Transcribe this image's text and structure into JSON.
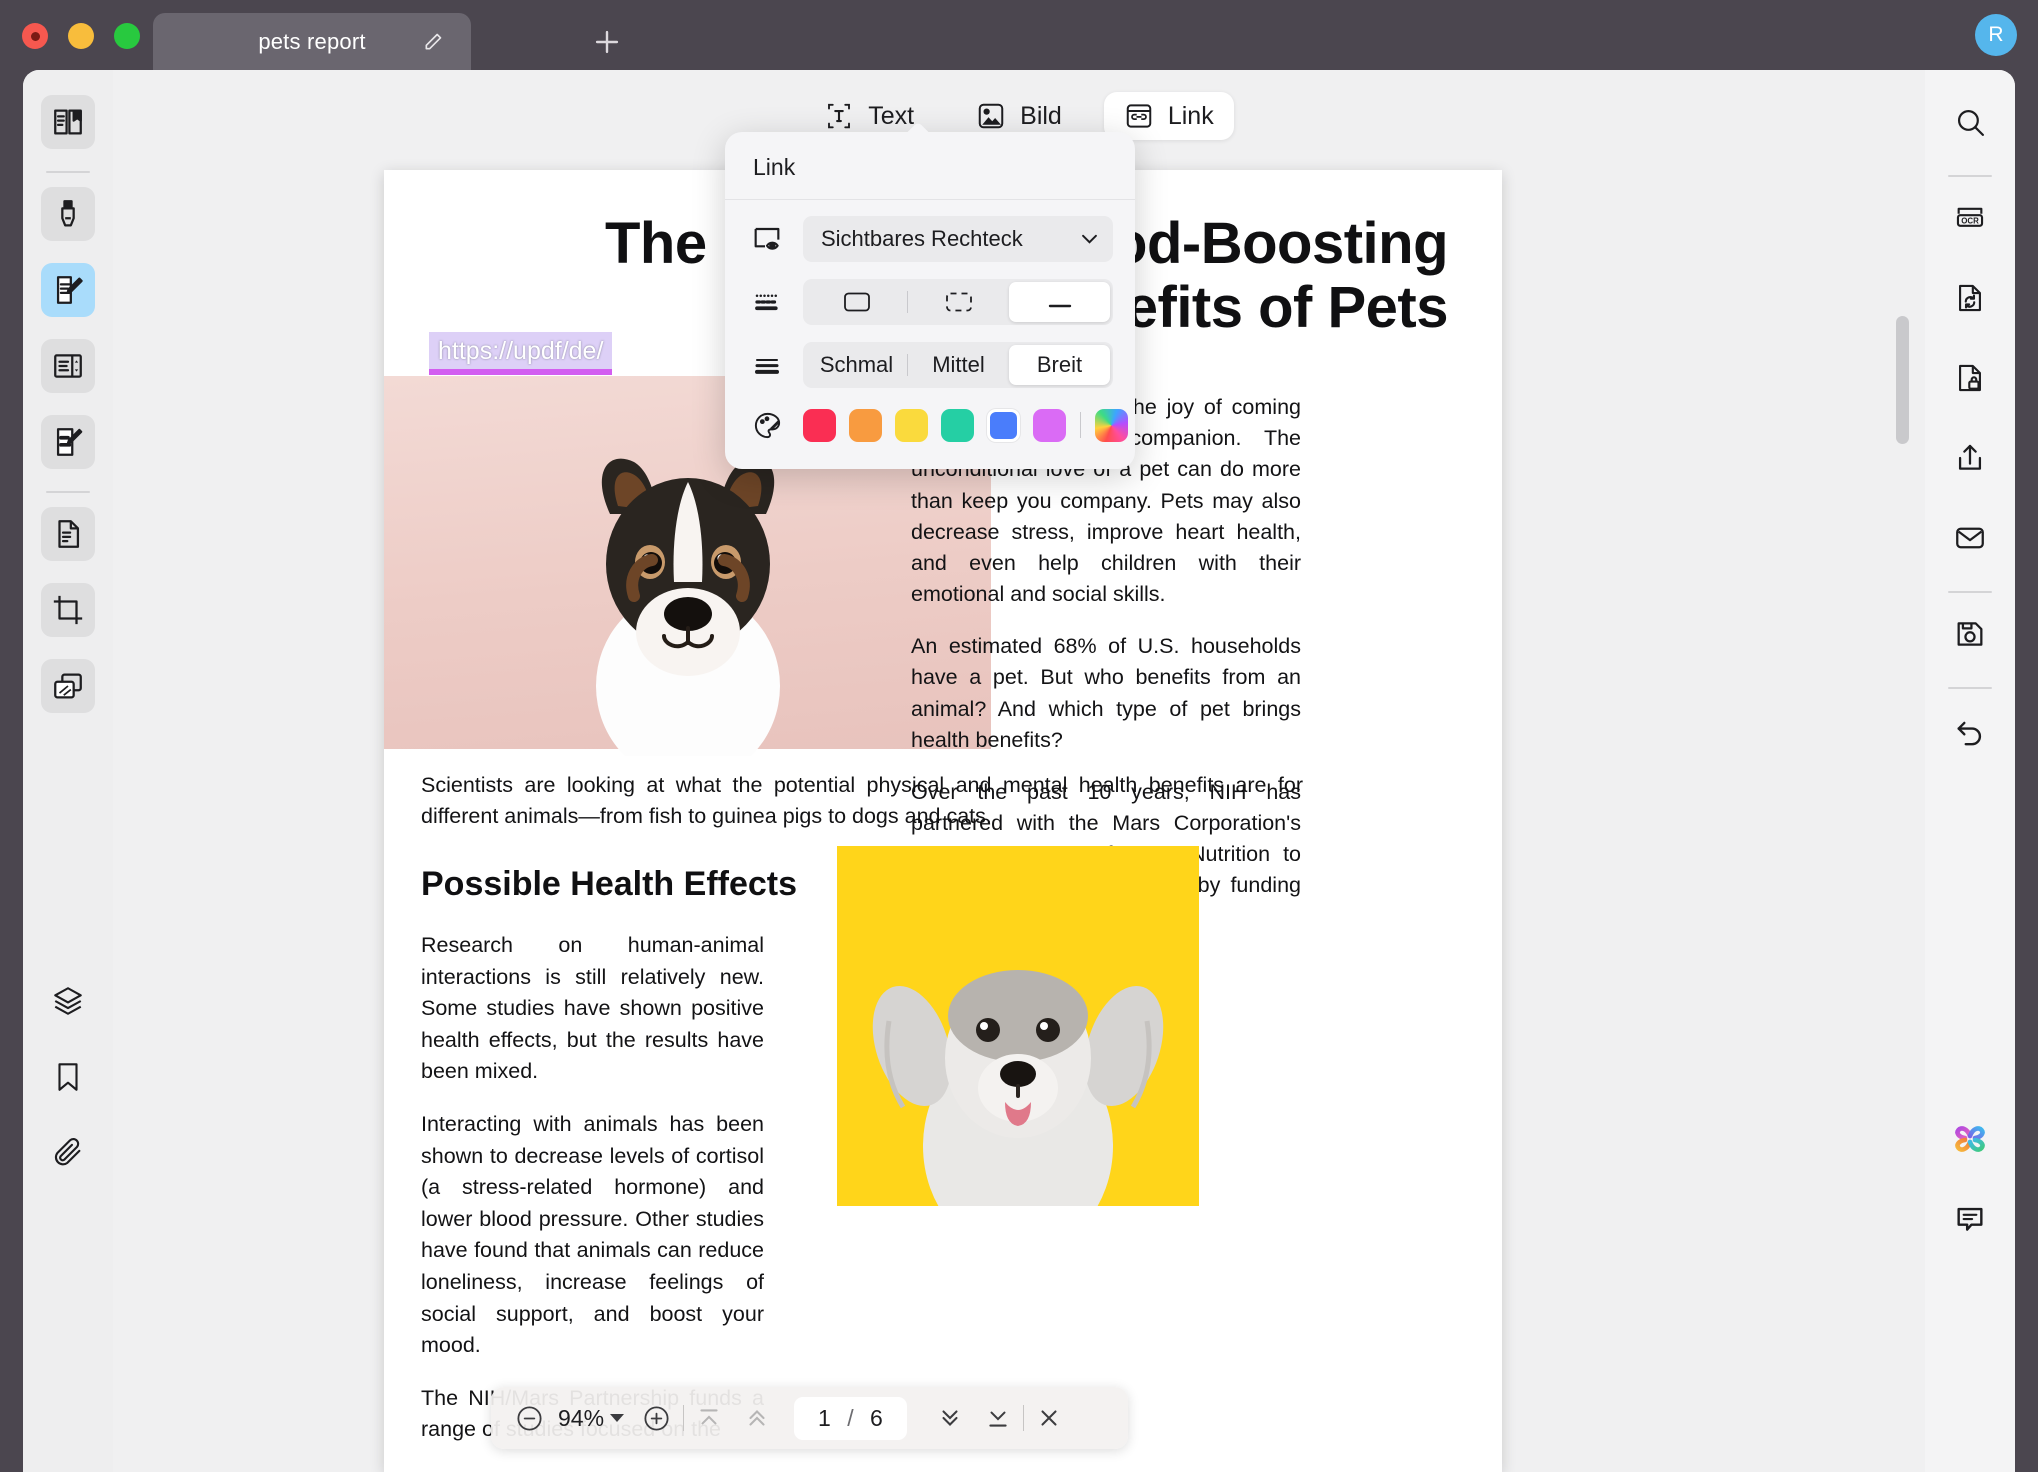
{
  "titlebar": {
    "tab_title": "pets report",
    "edit_icon": "pencil-icon",
    "new_tab_icon": "plus-icon",
    "avatar_initial": "R",
    "avatar_color": "#55b6ec"
  },
  "toolbar": {
    "tabs": [
      {
        "label": "Text",
        "icon": "text-box-icon",
        "selected": false
      },
      {
        "label": "Bild",
        "icon": "image-icon",
        "selected": false
      },
      {
        "label": "Link",
        "icon": "link-card-icon",
        "selected": true
      }
    ]
  },
  "left_rail": {
    "items": [
      {
        "name": "thumbnail-panel",
        "icon": "book-open-icon",
        "state": "shaded"
      },
      {
        "separator": true
      },
      {
        "name": "highlight-tool",
        "icon": "marker-icon",
        "state": "shaded"
      },
      {
        "name": "edit-tool",
        "icon": "document-pencil-icon",
        "state": "active"
      },
      {
        "name": "reading-tool",
        "icon": "document-columns-icon",
        "state": "shaded"
      },
      {
        "name": "form-tool",
        "icon": "form-pen-icon",
        "state": "shaded"
      },
      {
        "separator": true
      },
      {
        "name": "organize-pages",
        "icon": "page-fold-icon",
        "state": "shaded"
      },
      {
        "name": "crop-tool",
        "icon": "crop-icon",
        "state": "shaded"
      },
      {
        "name": "compare-tool",
        "icon": "stacked-pages-icon",
        "state": "shaded"
      }
    ],
    "bottom_items": [
      {
        "name": "layers",
        "icon": "layers-icon"
      },
      {
        "name": "bookmarks",
        "icon": "bookmark-icon"
      },
      {
        "name": "attachments",
        "icon": "paperclip-icon"
      }
    ]
  },
  "right_rail": {
    "items": [
      {
        "name": "search",
        "icon": "search-icon"
      },
      {
        "separator": true
      },
      {
        "name": "ocr",
        "icon": "ocr-icon",
        "label": "OCR"
      },
      {
        "name": "convert",
        "icon": "convert-document-icon"
      },
      {
        "name": "protect",
        "icon": "lock-document-icon"
      },
      {
        "name": "share",
        "icon": "share-icon"
      },
      {
        "name": "email",
        "icon": "envelope-icon"
      },
      {
        "separator": true
      },
      {
        "name": "save",
        "icon": "save-disk-icon"
      },
      {
        "separator": true
      },
      {
        "name": "undo",
        "icon": "undo-arrow-icon"
      }
    ],
    "bottom_items": [
      {
        "name": "ai-assistant",
        "icon": "ai-clover-icon"
      },
      {
        "name": "comments",
        "icon": "comment-bubble-icon"
      }
    ]
  },
  "popup": {
    "title": "Link",
    "appearance": {
      "icon": "visible-rectangle-icon",
      "value": "Sichtbares Rechteck",
      "chevron": "chevron-down-icon"
    },
    "border_style": {
      "icon": "border-style-icon",
      "options": [
        {
          "name": "solid-rectangle",
          "icon": "solid-rect-icon",
          "selected": false
        },
        {
          "name": "dashed-rectangle",
          "icon": "dashed-rect-icon",
          "selected": false
        },
        {
          "name": "underline",
          "icon": "underline-icon",
          "selected": true
        }
      ]
    },
    "thickness": {
      "icon": "line-thickness-icon",
      "options": [
        {
          "label": "Schmal",
          "selected": false
        },
        {
          "label": "Mittel",
          "selected": false
        },
        {
          "label": "Breit",
          "selected": true
        }
      ]
    },
    "color": {
      "icon": "palette-icon",
      "swatches": [
        {
          "name": "red",
          "hex": "#fa2e53",
          "selected": false
        },
        {
          "name": "orange",
          "hex": "#f89b40",
          "selected": false
        },
        {
          "name": "yellow",
          "hex": "#fada3d",
          "selected": false
        },
        {
          "name": "green",
          "hex": "#25cfa4",
          "selected": false
        },
        {
          "name": "blue",
          "hex": "#4a7dfb",
          "selected": true
        },
        {
          "name": "magenta",
          "hex": "#da6bf5",
          "selected": false
        }
      ],
      "custom": {
        "name": "custom-color-picker",
        "hex": "rainbow"
      }
    }
  },
  "document": {
    "title": "The Health and Mood-Boosting Benefits of Pets",
    "url_chip": "https://updf/de/",
    "url_chip_highlight": "#ddd0f7",
    "url_chip_underline": "#d35df0",
    "right_column": [
      "Nothing compares to the joy of coming home to a loyal companion. The unconditional love of a pet can do more than keep you company. Pets may also decrease stress, improve heart health, and even help children with their emotional and social skills.",
      "An estimated 68% of U.S. households have a pet. But who benefits from an animal? And which type of pet brings health benefits?",
      "Over the past 10 years, NIH has partnered with the Mars Corporation's WALTHAM Centre for Pet Nutrition to answer questions like these by funding research studies."
    ],
    "full_width_paragraph": "Scientists are looking at what the potential physical and mental health benefits are for different animals—from fish to guinea pigs to dogs and cats.",
    "section_heading": "Possible Health Effects",
    "left_column": [
      "Research on human-animal interactions is still relatively new. Some studies have shown positive health effects, but the results have been mixed.",
      "Interacting with animals has been shown to decrease levels of cortisol (a stress-related hormone) and lower blood pressure. Other studies have found that animals can reduce loneliness, increase feelings of social support, and boost your mood.",
      "The NIH/Mars Partnership funds a range of studies focused on the"
    ]
  },
  "bottombar": {
    "zoom_out_icon": "minus-circle-icon",
    "zoom_level": "94%",
    "zoom_caret": "caret-down-icon",
    "zoom_in_icon": "plus-circle-icon",
    "first_page_icon": "first-page-icon",
    "prev_page_icon": "prev-page-icon",
    "current_page": "1",
    "page_separator": "/",
    "total_pages": "6",
    "next_page_icon": "next-page-icon",
    "last_page_icon": "last-page-icon",
    "close_icon": "close-icon"
  }
}
